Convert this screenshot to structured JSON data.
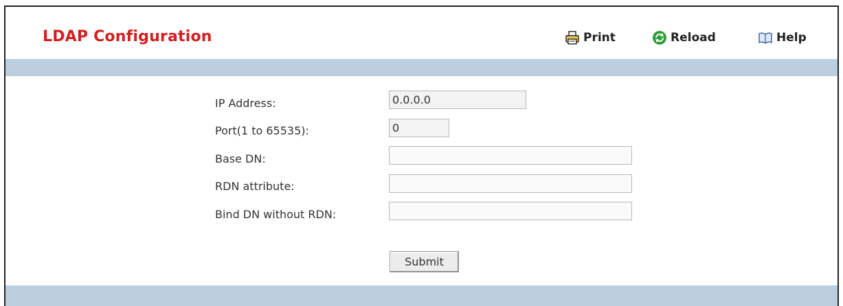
{
  "header": {
    "title": "LDAP Configuration",
    "toolbar": {
      "print_label": "Print",
      "reload_label": "Reload",
      "help_label": "Help"
    }
  },
  "form": {
    "ip_address": {
      "label": "IP Address:",
      "value": "0.0.0.0"
    },
    "port": {
      "label": "Port(1 to 65535):",
      "value": "0"
    },
    "base_dn": {
      "label": "Base DN:",
      "value": ""
    },
    "rdn_attribute": {
      "label": "RDN attribute:",
      "value": ""
    },
    "bind_dn": {
      "label": "Bind DN without RDN:",
      "value": ""
    },
    "submit_label": "Submit"
  },
  "colors": {
    "title": "#d31f1f",
    "bar": "#bccfde",
    "reload_icon": "#2e9e3a"
  },
  "icons": [
    "printer-icon",
    "reload-icon",
    "help-book-icon"
  ]
}
